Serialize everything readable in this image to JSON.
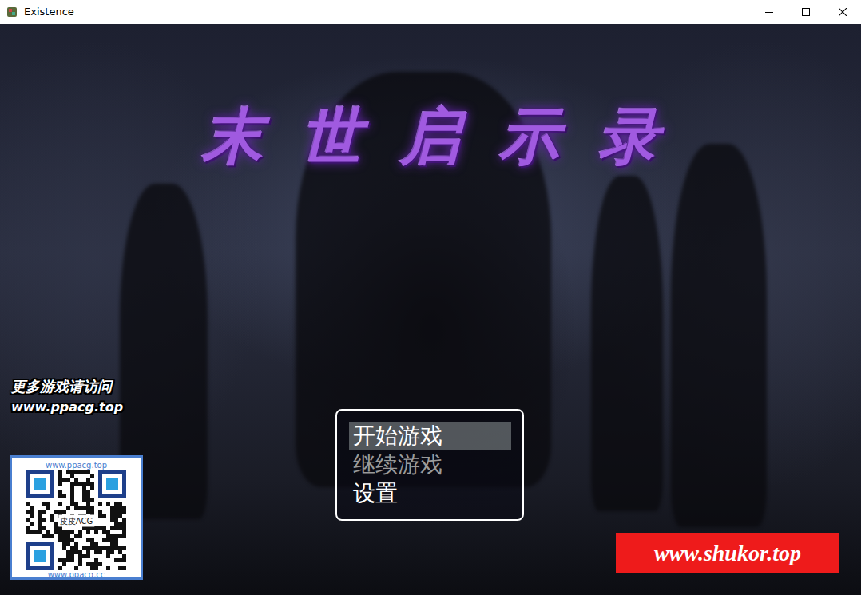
{
  "window": {
    "title": "Existence"
  },
  "game": {
    "title": "末世启示录"
  },
  "menu": {
    "items": [
      {
        "label": "开始游戏",
        "selected": true,
        "disabled": false
      },
      {
        "label": "继续游戏",
        "selected": false,
        "disabled": true
      },
      {
        "label": "设置",
        "selected": false,
        "disabled": false
      }
    ]
  },
  "watermarks": {
    "promo": "更多游戏请访问",
    "promo_url": "www.ppacg.top",
    "qr": {
      "top": "www.ppacg.top",
      "center": "皮皮ACG",
      "bottom": "www.ppacg.cc"
    },
    "banner": "www.shukor.top"
  }
}
